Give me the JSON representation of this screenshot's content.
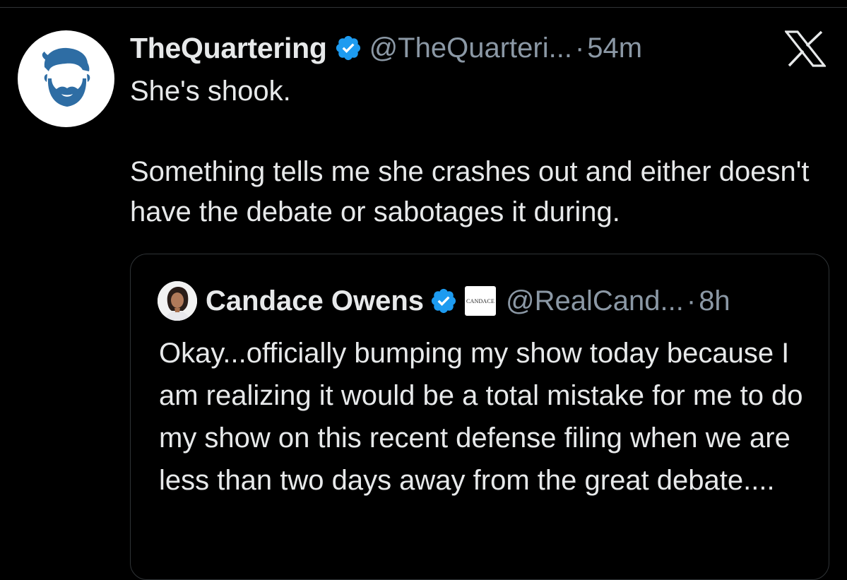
{
  "tweet": {
    "display_name": "TheQuartering",
    "handle": "@TheQuarteri...",
    "separator": "·",
    "time": "54m",
    "paragraphs": [
      "She's shook.",
      "Something tells me she crashes out and either doesn't have the debate or sabotages it during."
    ]
  },
  "quoted_tweet": {
    "display_name": "Candace Owens",
    "affiliate_label": "CANDACE",
    "handle": "@RealCand...",
    "separator": "·",
    "time": "8h",
    "text": "Okay...officially bumping my show today because I am realizing it would be a total mistake for me to do my show on this recent defense filing when we are less than two days away from the great debate...."
  },
  "icons": {
    "verified": "verified-badge-icon",
    "brand": "x-logo-icon"
  },
  "colors": {
    "background": "#000000",
    "text_primary": "#e7e9ea",
    "text_secondary": "#8b98a5",
    "verified_blue": "#1d9bf0",
    "avatar_blue": "#2e6da4",
    "border": "#2f3336"
  }
}
